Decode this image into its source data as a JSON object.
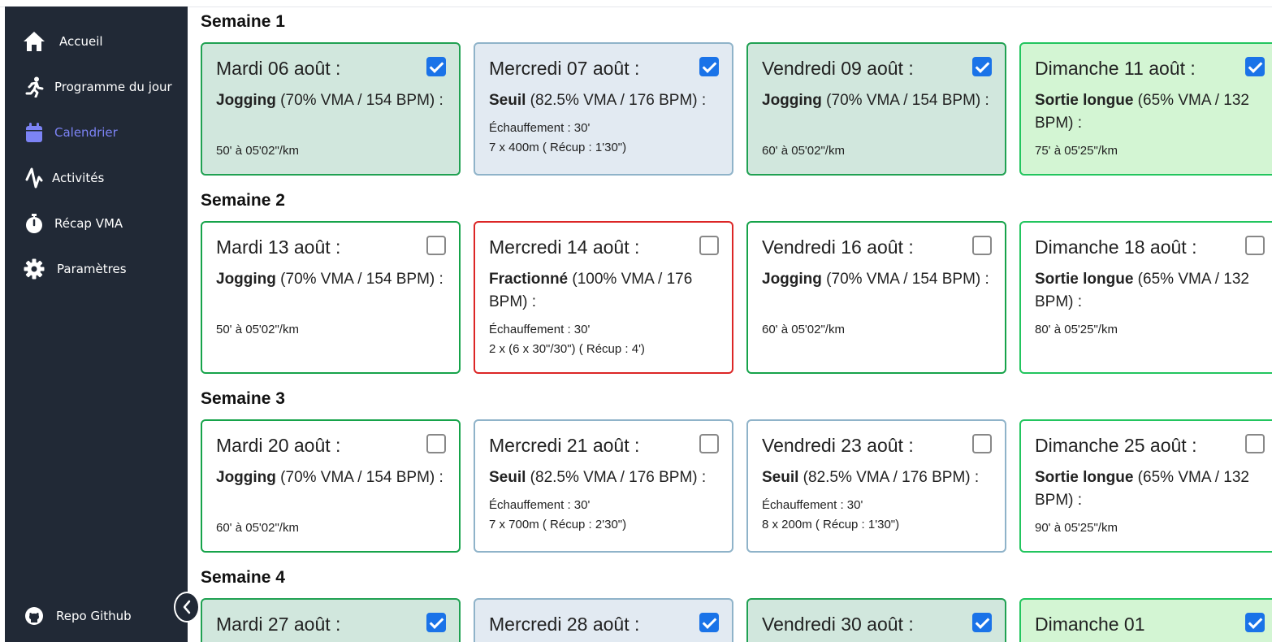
{
  "sidebar": {
    "items": [
      {
        "label": "Accueil",
        "icon": "home-icon"
      },
      {
        "label": "Programme du jour",
        "icon": "runner-icon"
      },
      {
        "label": "Calendrier",
        "icon": "calendar-icon"
      },
      {
        "label": "Activités",
        "icon": "activity-icon"
      },
      {
        "label": "Récap VMA",
        "icon": "stopwatch-icon"
      },
      {
        "label": "Paramètres",
        "icon": "gear-icon"
      }
    ],
    "active_item": "Calendrier",
    "footer_label": "Repo Github",
    "accent_color": "#7c83f5"
  },
  "weeks": [
    {
      "title": "Semaine 1",
      "days": [
        {
          "date": "Mardi 06 août :",
          "type": "Jogging",
          "intensity": " (70% VMA / 154 BPM) :",
          "details": [
            "50' à 05'02\"/km"
          ],
          "checked": true
        },
        {
          "date": "Mercredi 07 août :",
          "type": "Seuil",
          "intensity": " (82.5% VMA / 176 BPM) :",
          "details": [
            "Échauffement : 30'",
            "7 x 400m ( Récup : 1'30\")"
          ],
          "checked": true
        },
        {
          "date": "Vendredi 09 août :",
          "type": "Jogging",
          "intensity": " (70% VMA / 154 BPM) :",
          "details": [
            "60' à 05'02\"/km"
          ],
          "checked": true
        },
        {
          "date": "Dimanche 11 août :",
          "type": "Sortie longue",
          "intensity": " (65% VMA / 132 BPM) :",
          "details": [
            "75' à 05'25\"/km"
          ],
          "checked": true
        }
      ]
    },
    {
      "title": "Semaine 2",
      "days": [
        {
          "date": "Mardi 13 août :",
          "type": "Jogging",
          "intensity": " (70% VMA / 154 BPM) :",
          "details": [
            "50' à 05'02\"/km"
          ],
          "checked": false
        },
        {
          "date": "Mercredi 14 août :",
          "type": "Fractionné",
          "intensity": " (100% VMA / 176 BPM) :",
          "details": [
            "Échauffement : 30'",
            "2 x (6 x 30\"/30\") ( Récup : 4')"
          ],
          "checked": false
        },
        {
          "date": "Vendredi 16 août :",
          "type": "Jogging",
          "intensity": " (70% VMA / 154 BPM) :",
          "details": [
            "60' à 05'02\"/km"
          ],
          "checked": false
        },
        {
          "date": "Dimanche 18 août :",
          "type": "Sortie longue",
          "intensity": " (65% VMA / 132 BPM) :",
          "details": [
            "80' à 05'25\"/km"
          ],
          "checked": false
        }
      ]
    },
    {
      "title": "Semaine 3",
      "days": [
        {
          "date": "Mardi 20 août :",
          "type": "Jogging",
          "intensity": " (70% VMA / 154 BPM) :",
          "details": [
            "60' à 05'02\"/km"
          ],
          "checked": false
        },
        {
          "date": "Mercredi 21 août :",
          "type": "Seuil",
          "intensity": " (82.5% VMA / 176 BPM) :",
          "details": [
            "Échauffement : 30'",
            "7 x 700m ( Récup : 2'30\")"
          ],
          "checked": false
        },
        {
          "date": "Vendredi 23 août :",
          "type": "Seuil",
          "intensity": " (82.5% VMA / 176 BPM) :",
          "details": [
            "Échauffement : 30'",
            "8 x 200m ( Récup : 1'30\")"
          ],
          "checked": false
        },
        {
          "date": "Dimanche 25 août :",
          "type": "Sortie longue",
          "intensity": " (65% VMA / 132 BPM) :",
          "details": [
            "90' à 05'25\"/km"
          ],
          "checked": false
        }
      ]
    },
    {
      "title": "Semaine 4",
      "days": [
        {
          "date": "Mardi 27 août :",
          "type": "",
          "intensity": "",
          "details": [],
          "checked": true
        },
        {
          "date": "Mercredi 28 août :",
          "type": "",
          "intensity": "",
          "details": [],
          "checked": true
        },
        {
          "date": "Vendredi 30 août :",
          "type": "",
          "intensity": "",
          "details": [],
          "checked": true
        },
        {
          "date": "Dimanche 01",
          "type": "",
          "intensity": "",
          "details": [],
          "checked": true
        }
      ]
    }
  ]
}
